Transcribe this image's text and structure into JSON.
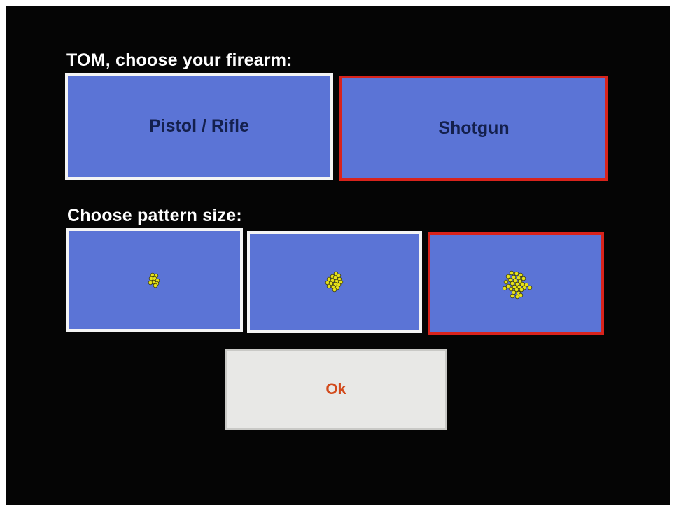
{
  "firearm": {
    "heading": "TOM, choose your firearm:",
    "options": [
      {
        "label": "Pistol / Rifle",
        "selected": false
      },
      {
        "label": "Shotgun",
        "selected": true
      }
    ]
  },
  "pattern": {
    "heading": "Choose pattern size:",
    "options": [
      {
        "size": "small",
        "selected": false,
        "icon": "small-shot-pattern-icon"
      },
      {
        "size": "medium",
        "selected": false,
        "icon": "medium-shot-pattern-icon"
      },
      {
        "size": "large",
        "selected": true,
        "icon": "large-shot-pattern-icon"
      }
    ]
  },
  "ok_button": {
    "label": "Ok"
  },
  "colors": {
    "background": "#050505",
    "button_fill": "#5b74d6",
    "border_default": "#f4f4f4",
    "border_selected": "#d8231c",
    "pellet": "#e6e21a",
    "ok_text": "#d24a1c"
  }
}
